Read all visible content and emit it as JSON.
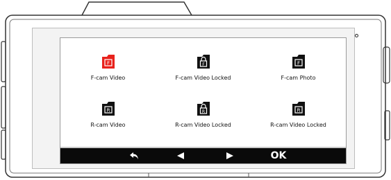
{
  "files": [
    {
      "label": "F-cam Video",
      "icon": "folder-f-icon",
      "selected": true
    },
    {
      "label": "F-cam Video Locked",
      "icon": "folder-lock-f-icon",
      "selected": false
    },
    {
      "label": "F-cam Photo",
      "icon": "folder-f-icon",
      "selected": false
    },
    {
      "label": "R-cam Video",
      "icon": "folder-r-icon",
      "selected": false
    },
    {
      "label": "R-cam Video Locked",
      "icon": "folder-lock-r-icon",
      "selected": false
    },
    {
      "label": "R-cam Video Locked",
      "icon": "folder-r-icon",
      "selected": false
    }
  ],
  "toolbar": {
    "back_icon": "back-arrow-icon",
    "prev_icon": "left-triangle-icon",
    "next_icon": "right-triangle-icon",
    "ok_label": "OK"
  },
  "colors": {
    "selected": "#e8221c",
    "icon": "#111111",
    "toolbar_bg": "#0a0a0a"
  }
}
